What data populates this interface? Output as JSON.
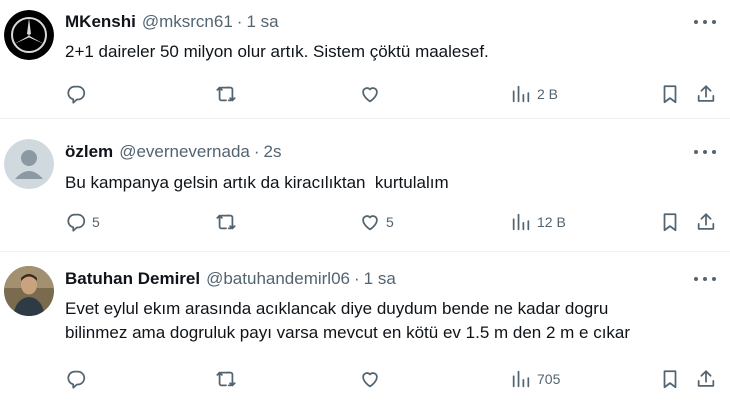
{
  "tweets": [
    {
      "name": "MKenshi",
      "handle": "@mksrcn61",
      "separator": "·",
      "time": "1 sa",
      "text": "2+1 daireler 50 milyon olur artık. Sistem çöktü maalesef.",
      "reply_count": "",
      "retweet_count": "",
      "like_count": "",
      "views": "2 B",
      "avatar": "mercedes-logo-avatar"
    },
    {
      "name": "özlem",
      "handle": "@evernevernada",
      "separator": "·",
      "time": "2s",
      "text": "Bu kampanya gelsin artık da kiracılıktan  kurtulalım",
      "reply_count": "5",
      "retweet_count": "",
      "like_count": "5",
      "views": "12 B",
      "avatar": "default-profile-avatar"
    },
    {
      "name": "Batuhan Demirel",
      "handle": "@batuhandemirl06",
      "separator": "·",
      "time": "1 sa",
      "text": "Evet eylul ekım arasında acıklancak diye duydum bende ne kadar dogru\nbilinmez ama dogruluk payı varsa mevcut en kötü ev 1.5 m den 2 m e cıkar",
      "reply_count": "",
      "retweet_count": "",
      "like_count": "",
      "views": "705",
      "avatar": "photo-avatar"
    }
  ],
  "icons": {
    "reply": "reply-icon",
    "retweet": "retweet-icon",
    "like": "heart-icon",
    "views": "views-chart-icon",
    "bookmark": "bookmark-icon",
    "share": "share-icon",
    "more": "more-dots-icon"
  },
  "colors": {
    "text": "#0f1419",
    "secondary": "#536471",
    "divider": "#eff3f4"
  }
}
